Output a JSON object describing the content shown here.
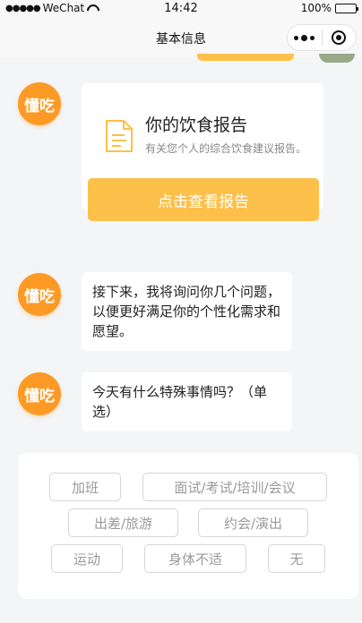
{
  "status_bar": {
    "carrier": "WeChat",
    "signal": "●●●●●",
    "time": "14:42",
    "battery": "100%"
  },
  "nav": {
    "title": "基本信息"
  },
  "messages": {
    "avatar_label": "懂吃",
    "report": {
      "title": "你的饮食报告",
      "subtitle": "有关您个人的综合饮食建议报告。",
      "button": "点击查看报告"
    },
    "intro": "接下来，我将询问你几个问题，以便更好满足你的个性化需求和愿望。",
    "question": "今天有什么特殊事情吗？（单选）"
  },
  "options": [
    "加班",
    "面试/考试/培训/会议",
    "出差/旅游",
    "约会/演出",
    "运动",
    "身体不适",
    "无"
  ],
  "colors": {
    "accent": "#fdc04a",
    "avatar": "#fc9a25",
    "background": "#f4f5f7"
  }
}
